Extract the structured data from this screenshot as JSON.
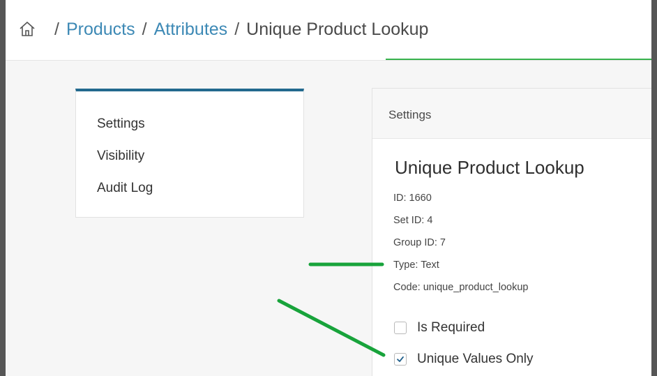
{
  "breadcrumb": {
    "items": [
      "Products",
      "Attributes"
    ],
    "separator": "/",
    "current": "Unique Product Lookup"
  },
  "sidebar": {
    "items": [
      {
        "label": "Settings"
      },
      {
        "label": "Visibility"
      },
      {
        "label": "Audit Log"
      }
    ]
  },
  "main": {
    "header": "Settings",
    "title": "Unique Product Lookup",
    "meta": {
      "id": "ID: 1660",
      "set_id": "Set ID: 4",
      "group_id": "Group ID: 7",
      "type": "Type: Text",
      "code": "Code: unique_product_lookup"
    },
    "checkboxes": [
      {
        "label": "Is Required",
        "checked": false
      },
      {
        "label": "Unique Values Only",
        "checked": true
      }
    ]
  },
  "colors": {
    "link": "#3d89b5",
    "sidebar_accent": "#22698e",
    "tab_accent": "#37b24d",
    "annotation": "#18a33b"
  },
  "icons": {
    "breadcrumb_home": "home-icon",
    "checkbox_check": "checkmark-icon"
  }
}
